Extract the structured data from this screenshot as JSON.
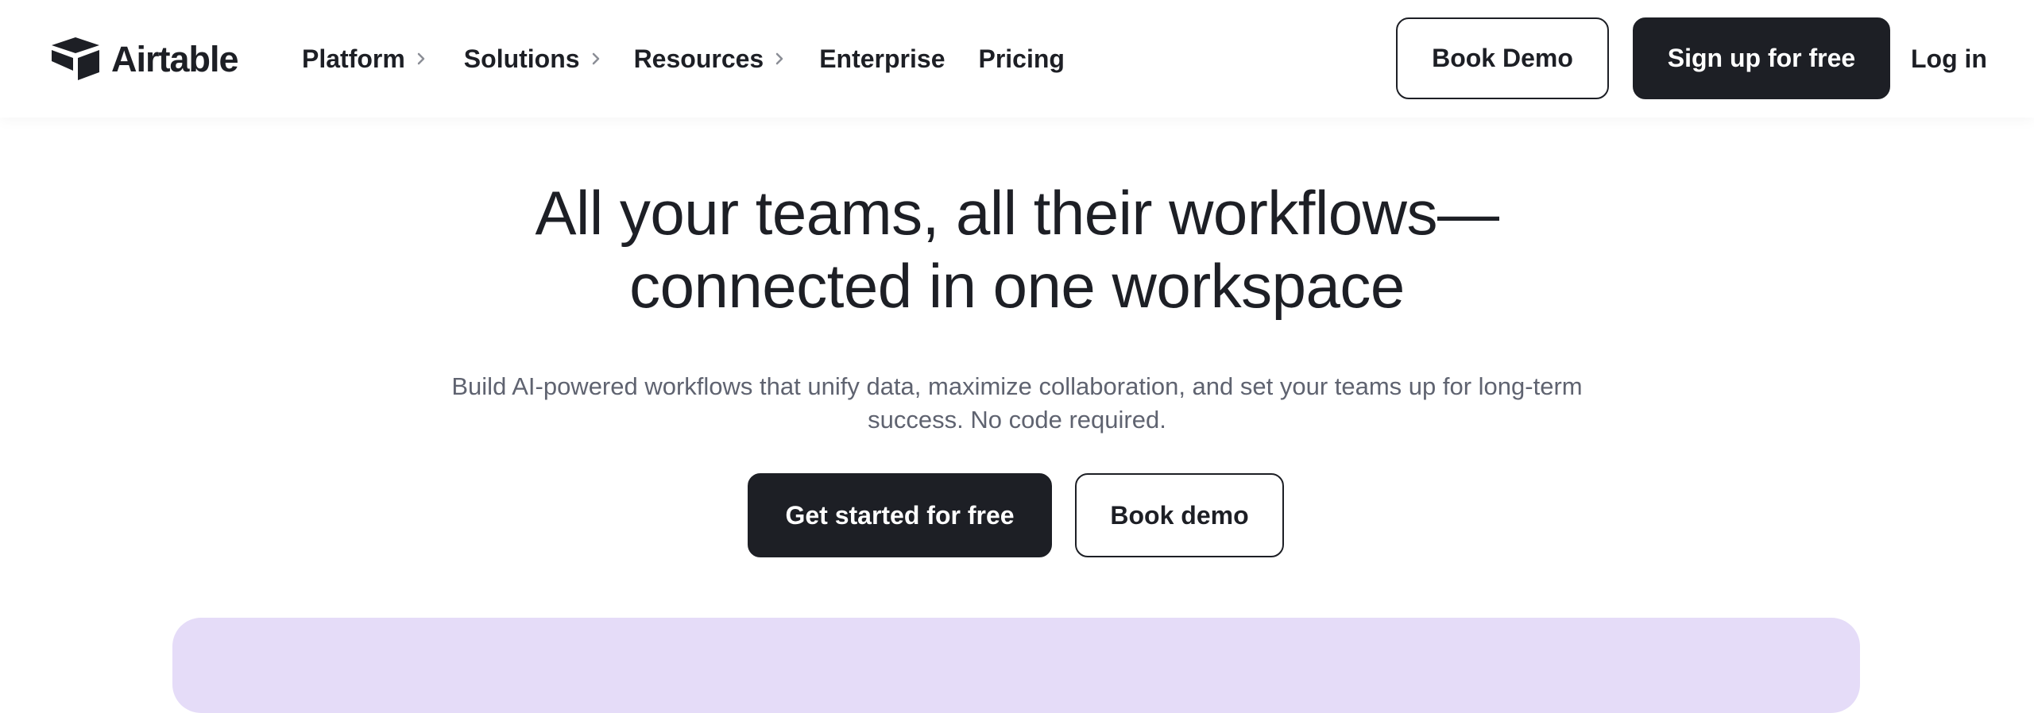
{
  "brand": {
    "name": "Airtable",
    "logo_icon": "airtable-box-logo-icon"
  },
  "nav": {
    "items": [
      {
        "label": "Platform",
        "has_submenu": true
      },
      {
        "label": "Solutions",
        "has_submenu": true
      },
      {
        "label": "Resources",
        "has_submenu": true
      },
      {
        "label": "Enterprise",
        "has_submenu": false
      },
      {
        "label": "Pricing",
        "has_submenu": false
      }
    ],
    "chevron_icon": "chevron-right-icon"
  },
  "header_actions": {
    "book_demo": "Book Demo",
    "sign_up": "Sign up for free",
    "log_in": "Log in"
  },
  "hero": {
    "title_line_1": "All your teams, all their workflows—",
    "title_line_2": "connected in one workspace",
    "subtitle_line_1": "Build AI-powered workflows that unify data, maximize collaboration, and set your teams up for long-term",
    "subtitle_line_2": "success. No code required.",
    "primary_cta": "Get started for free",
    "secondary_cta": "Book demo"
  },
  "colors": {
    "text_primary": "#1d1f25",
    "text_secondary": "#5f6370",
    "button_dark": "#1d1f25",
    "preview_panel": "#e5dcf8",
    "background": "#ffffff"
  }
}
